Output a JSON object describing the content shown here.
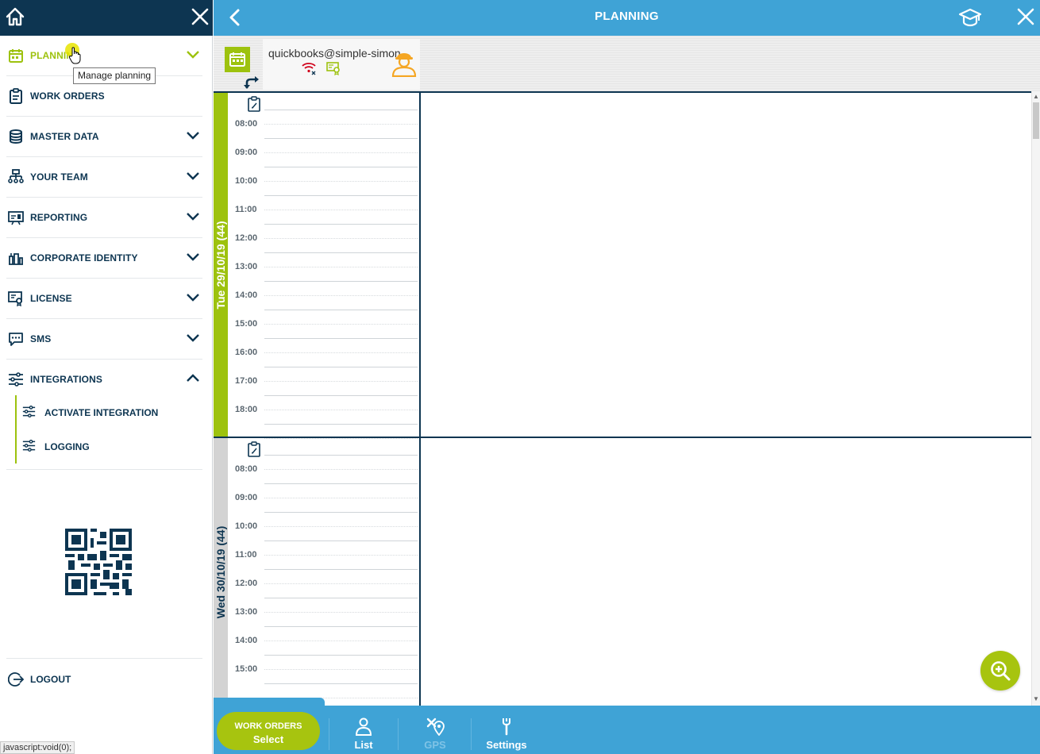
{
  "colors": {
    "navy": "#0d3551",
    "blue": "#3fa3d6",
    "lime": "#9dc20e",
    "day_active_bg": "#9dc20e",
    "day_inactive_bg": "#d3d3d3"
  },
  "sidebar": {
    "items": [
      {
        "label": "PLANNING",
        "icon": "calendar-icon",
        "active": true
      },
      {
        "label": "WORK ORDERS",
        "icon": "clipboard-icon"
      },
      {
        "label": "MASTER DATA",
        "icon": "database-icon"
      },
      {
        "label": "YOUR TEAM",
        "icon": "team-icon"
      },
      {
        "label": "REPORTING",
        "icon": "report-icon"
      },
      {
        "label": "CORPORATE IDENTITY",
        "icon": "identity-icon"
      },
      {
        "label": "LICENSE",
        "icon": "license-icon"
      },
      {
        "label": "SMS",
        "icon": "sms-icon"
      },
      {
        "label": "INTEGRATIONS",
        "icon": "sliders-icon",
        "expanded": true
      }
    ],
    "sub_items": [
      {
        "label": "ACTIVATE INTEGRATION",
        "icon": "sliders-icon"
      },
      {
        "label": "LOGGING",
        "icon": "sliders-icon"
      }
    ],
    "tooltip": "Manage planning",
    "logout_label": "LOGOUT"
  },
  "status_bar": "javascript:void(0);",
  "header": {
    "title": "PLANNING"
  },
  "resource": {
    "name": "quickbooks@simple-simon"
  },
  "days": [
    {
      "label": "Tue 29/10/19 (44)",
      "active": true,
      "times": [
        "08:00",
        "09:00",
        "10:00",
        "11:00",
        "12:00",
        "13:00",
        "14:00",
        "15:00",
        "16:00",
        "17:00",
        "18:00"
      ]
    },
    {
      "label": "Wed 30/10/19 (44)",
      "active": false,
      "times": [
        "08:00",
        "09:00",
        "10:00",
        "11:00",
        "12:00",
        "13:00",
        "14:00",
        "15:00"
      ]
    }
  ],
  "bottom": {
    "work_orders_line1": "WORK ORDERS",
    "work_orders_line2": "Select",
    "tabs": [
      {
        "label": "List",
        "icon": "person-icon"
      },
      {
        "label": "GPS",
        "icon": "gps-icon"
      },
      {
        "label": "Settings",
        "icon": "wrench-icon"
      }
    ]
  }
}
